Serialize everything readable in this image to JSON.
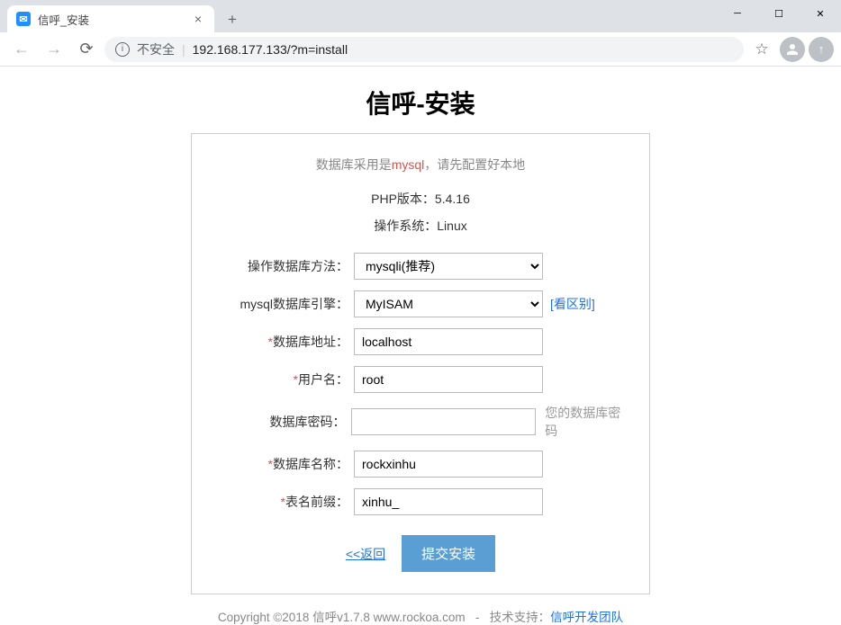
{
  "window": {
    "tab_title": "信呼_安装",
    "secure_label": "不安全",
    "url": "192.168.177.133/?m=install"
  },
  "page": {
    "title": "信呼-安装",
    "notice_pre": "数据库采用是",
    "notice_mysql": "mysql",
    "notice_post": "，请先配置好本地",
    "php_version": "PHP版本：5.4.16",
    "os": "操作系统：Linux"
  },
  "form": {
    "db_method": {
      "label": "操作数据库方法：",
      "value": "mysqli(推荐)"
    },
    "db_engine": {
      "label": "mysql数据库引擎：",
      "value": "MyISAM",
      "hint": "[看区别]"
    },
    "db_host": {
      "label": "数据库地址：",
      "req": "*",
      "value": "localhost"
    },
    "db_user": {
      "label": "用户名：",
      "req": "*",
      "value": "root"
    },
    "db_pass": {
      "label": "数据库密码：",
      "value": "",
      "hint": "您的数据库密码"
    },
    "db_name": {
      "label": "数据库名称：",
      "req": "*",
      "value": "rockxinhu"
    },
    "tb_prefix": {
      "label": "表名前缀：",
      "req": "*",
      "value": "xinhu_"
    }
  },
  "buttons": {
    "back": "<<返回",
    "submit": "提交安装"
  },
  "footer": {
    "copyright": "Copyright ©2018 信呼v1.7.8 www.rockoa.com",
    "sep": "-",
    "support_label": "技术支持：",
    "support_link": "信呼开发团队"
  }
}
